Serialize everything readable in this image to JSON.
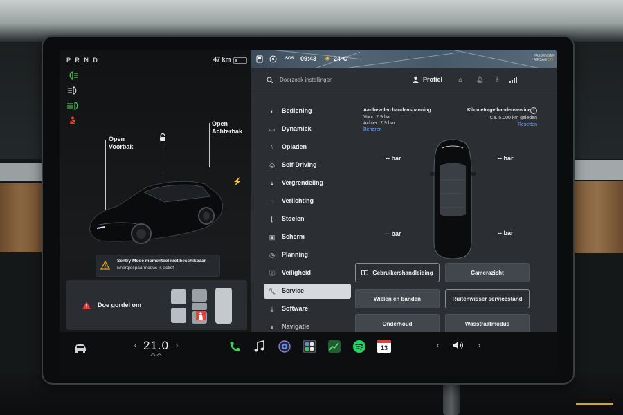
{
  "car_panel": {
    "gear": [
      "P",
      "R",
      "N",
      "D"
    ],
    "range": "47 km",
    "battery_level": 0.25,
    "open_front_label": "Open\nVoorbak",
    "open_rear_label": "Open\nAchterbak",
    "sentry_line1": "Sentry Mode momenteel niet beschikbaar",
    "sentry_line2": "Energiespaarmodus is actief",
    "belt_warning": "Doe gordel om",
    "status_icons": [
      "low-beam-icon",
      "parking-lights-icon",
      "fog-lights-icon",
      "seatbelt-warning-icon"
    ]
  },
  "status_bar": {
    "time": "09:43",
    "temperature": "24°C",
    "sos": "SOS",
    "airbag_line1": "PASSENGER",
    "airbag_line2": "AIRBAG",
    "airbag_state": "ON"
  },
  "search": {
    "placeholder": "Doorzoek instellingen"
  },
  "profile": {
    "label": "Profiel"
  },
  "menu": [
    {
      "label": "Bediening",
      "icon": "toggle-icon"
    },
    {
      "label": "Dynamiek",
      "icon": "car-icon"
    },
    {
      "label": "Opladen",
      "icon": "bolt-icon"
    },
    {
      "label": "Self-Driving",
      "icon": "steering-wheel-icon"
    },
    {
      "label": "Vergrendeling",
      "icon": "lock-icon"
    },
    {
      "label": "Verlichting",
      "icon": "sun-icon"
    },
    {
      "label": "Stoelen",
      "icon": "seat-icon"
    },
    {
      "label": "Scherm",
      "icon": "display-icon"
    },
    {
      "label": "Planning",
      "icon": "clock-icon"
    },
    {
      "label": "Veiligheid",
      "icon": "info-icon"
    },
    {
      "label": "Service",
      "icon": "wrench-icon",
      "active": true
    },
    {
      "label": "Software",
      "icon": "download-icon"
    },
    {
      "label": "Navigatie",
      "icon": "navigation-icon"
    }
  ],
  "service": {
    "tire_pressure_title": "Aanbevolen bandenspanning",
    "front": "Voor: 2.9 bar",
    "rear": "Achter: 2.9 bar",
    "manage_link": "Beheren",
    "mileage_title": "Kilometrage bandenservice",
    "mileage_sub": "Ca. 5.000 km geleden",
    "reset_link": "Resetten",
    "tire_fl": "-- bar",
    "tire_fr": "-- bar",
    "tire_rl": "-- bar",
    "tire_rr": "-- bar",
    "buttons": [
      {
        "label": "Gebruikershandleiding",
        "icon": "book-icon"
      },
      {
        "label": "Camerazicht"
      },
      {
        "label": "Wielen en banden"
      },
      {
        "label": "Ruitenwisser servicestand"
      },
      {
        "label": "Onderhoud"
      },
      {
        "label": "Wasstraatmodus"
      }
    ]
  },
  "dock": {
    "temperature": "21.0",
    "temp_left": "‹",
    "temp_right": "›",
    "vol_left": "‹",
    "vol_right": "›",
    "calendar_day": "13",
    "apps": [
      "phone-icon",
      "music-icon",
      "camera-icon",
      "apps-launcher-icon",
      "stocks-icon",
      "spotify-icon",
      "calendar-icon"
    ],
    "colors": {
      "phone": "#3ecf5a",
      "spotify": "#1ed760",
      "calendar": "#e2413a",
      "stocks": "#2fb24f"
    }
  }
}
